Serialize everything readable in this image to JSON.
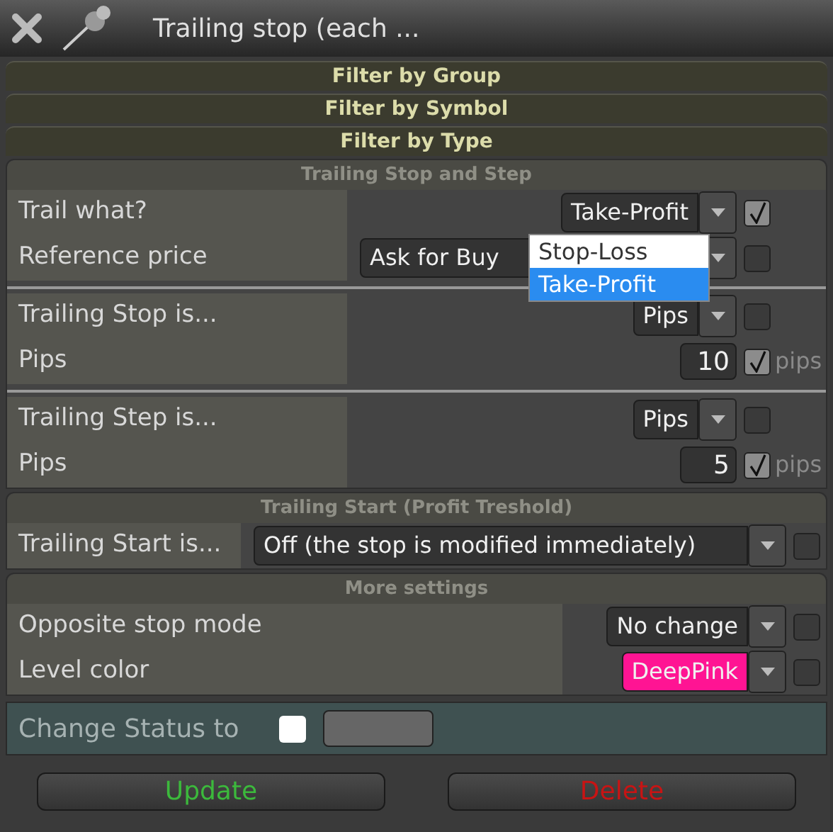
{
  "window": {
    "title": "Trailing stop (each ..."
  },
  "filters": [
    {
      "label": "Filter by Group"
    },
    {
      "label": "Filter by Symbol"
    },
    {
      "label": "Filter by Type"
    }
  ],
  "sections": [
    {
      "title": "Trailing Stop and Step",
      "groups": [
        [
          {
            "kind": "select",
            "label": "Trail what?",
            "value": "Take-Profit",
            "checked": true,
            "dropdown": [
              {
                "label": "Stop-Loss",
                "selected": false
              },
              {
                "label": "Take-Profit",
                "selected": true
              }
            ]
          },
          {
            "kind": "wide-select",
            "label": "Reference price",
            "value": "Ask for Buy",
            "checked": false
          }
        ],
        [
          {
            "kind": "select",
            "label": "Trailing Stop is...",
            "value": "Pips",
            "checked": false
          },
          {
            "kind": "number",
            "label": "Pips",
            "value": "10",
            "checked": true,
            "unit": "pips"
          }
        ],
        [
          {
            "kind": "select",
            "label": "Trailing Step is...",
            "value": "Pips",
            "checked": false
          },
          {
            "kind": "number",
            "label": "Pips",
            "value": "5",
            "checked": true,
            "unit": "pips"
          }
        ]
      ]
    },
    {
      "title": "Trailing Start (Profit Treshold)",
      "groups": [
        [
          {
            "kind": "wide-select",
            "label": "Trailing Start is...",
            "value": "Off (the stop is modified immediately)",
            "checked": false
          }
        ]
      ]
    },
    {
      "title": "More settings",
      "groups": [
        [
          {
            "kind": "select",
            "label": "Opposite stop mode",
            "value": "No change",
            "checked": false
          },
          {
            "kind": "color-select",
            "label": "Level color",
            "value": "DeepPink",
            "color": "#ff1493",
            "checked": false
          }
        ]
      ]
    }
  ],
  "status": {
    "label": "Change Status to",
    "checked": false
  },
  "buttons": [
    {
      "label": "Update",
      "color": "#3cb93c"
    },
    {
      "label": "Delete",
      "color": "#c81414"
    }
  ]
}
